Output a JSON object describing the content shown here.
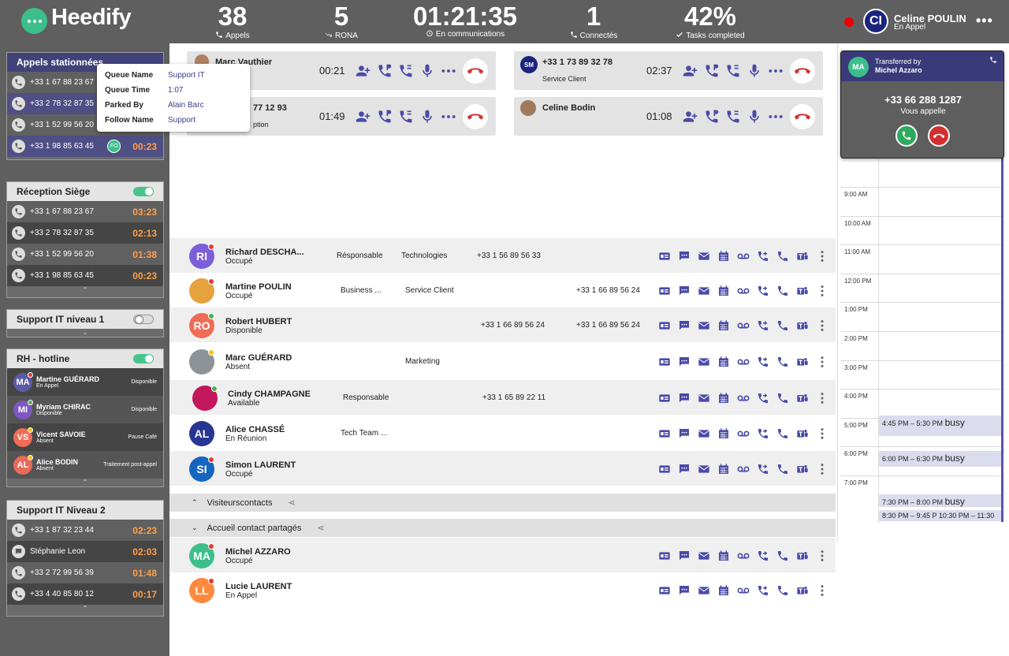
{
  "brand": {
    "name": "Heedify"
  },
  "stats": [
    {
      "value": "38",
      "label": "Appels"
    },
    {
      "value": "5",
      "label": "RONA"
    },
    {
      "value": "01:21:35",
      "label": "En communications"
    },
    {
      "value": "1",
      "label": "Connectés"
    },
    {
      "value": "42%",
      "label": "Tasks completed"
    }
  ],
  "user": {
    "initials": "CI",
    "name": "Celine POULIN",
    "status": "En Appel"
  },
  "parked": {
    "title": "Appels stationnées",
    "rows": [
      {
        "number": "+33 1 67 88 23 67"
      },
      {
        "number": "+33 2 78 32 87 35"
      },
      {
        "number": "+33 1 52 99 56 20"
      },
      {
        "number": "+33 1 98 85 63 45",
        "badge": "FO",
        "time": "00:23"
      }
    ]
  },
  "tooltip": {
    "rows": [
      {
        "key": "Queue Name",
        "value": "Support IT"
      },
      {
        "key": "Queue Time",
        "value": "1:07"
      },
      {
        "key": "Parked By",
        "value": "Alain Barc"
      },
      {
        "key": "Follow Name",
        "value": "Support"
      }
    ]
  },
  "reception": {
    "title": "Réception Siège",
    "rows": [
      {
        "number": "+33 1 67 88 23 67",
        "time": "03:23"
      },
      {
        "number": "+33 2 78 32 87 35",
        "time": "02:13"
      },
      {
        "number": "+33 1 52 99 56 20",
        "time": "01:38"
      },
      {
        "number": "+33 1 98 85 63 45",
        "time": "00:23"
      }
    ]
  },
  "support1": {
    "title": "Support IT niveau 1"
  },
  "rh": {
    "title": "RH - hotline",
    "rows": [
      {
        "initials": "MA",
        "name": "Martine GUÉRARD",
        "sub": "En Appel",
        "right": "Disponible",
        "color": "#5b5ba5",
        "dot": "#e53935"
      },
      {
        "initials": "MI",
        "name": "Myriam CHIRAC",
        "sub": "Disponible",
        "right": "Disponible",
        "color": "#7e57c2",
        "dot": "#4caf50"
      },
      {
        "initials": "VS",
        "name": "Vicent SAVOIE",
        "sub": "Absent",
        "right": "Pause Café",
        "color": "#ef6c57",
        "dot": "#ffc107"
      },
      {
        "initials": "AL",
        "name": "Alice BODIN",
        "sub": "Absent",
        "right": "Traitement post-appel",
        "color": "#e86a5a",
        "dot": "#ffc107"
      }
    ]
  },
  "support2": {
    "title": "Support IT Niveau 2",
    "rows": [
      {
        "number": "+33 1 87 32 23 44",
        "time": "02:23"
      },
      {
        "number": "Stéphanie Leon",
        "time": "02:03"
      },
      {
        "number": "+33 2 72 99 56 39",
        "time": "01:48"
      },
      {
        "number": "+33 4 40 85 80 12",
        "time": "00:17"
      }
    ]
  },
  "calls": [
    {
      "name": "Marc Vauthier",
      "sub": "",
      "time": "00:21"
    },
    {
      "name": "+33 1 73 89 32 78",
      "initials": "SM",
      "sub": "Service Client",
      "time": "02:37"
    },
    {
      "name": "77 12 93",
      "sub": "ption",
      "time": "01:49"
    },
    {
      "name": "Celine Bodin",
      "sub": "",
      "time": "01:08"
    }
  ],
  "contacts": [
    {
      "initials": "RI",
      "name": "Richard DESCHA...",
      "status": "Occupé",
      "color": "#7b5fd8",
      "dot": "#e53935",
      "f1": "Résponsable",
      "f2": "Technologies",
      "f3": "+33 1 56 89 56 33",
      "f4": ""
    },
    {
      "initials": "",
      "name": "Martine POULIN",
      "status": "Occupé",
      "color": "#e6a23c",
      "dot": "#e53935",
      "f1": "Business ...",
      "f2": "Service Client",
      "f3": "",
      "f4": "+33 1 66 89 56 24"
    },
    {
      "initials": "RO",
      "name": "Robert HUBERT",
      "status": "Disponible",
      "color": "#ef6c57",
      "dot": "#4caf50",
      "f1": "",
      "f2": "",
      "f3": "+33 1 66 89 56 24",
      "f4": "+33 1 66 89 56 24"
    },
    {
      "initials": "",
      "name": "Marc GUÉRARD",
      "status": "Absent",
      "color": "#8d9499",
      "dot": "#ffc107",
      "f1": "",
      "f2": "Marketing",
      "f3": "",
      "f4": ""
    },
    {
      "initials": "",
      "name": "Cindy CHAMPAGNE",
      "status": "Available",
      "color": "#c2185b",
      "dot": "#4caf50",
      "f1": "Responsable",
      "f2": "",
      "f3": "+33 1 65 89 22 11",
      "f4": ""
    },
    {
      "initials": "AL",
      "name": "Alice CHASSÉ",
      "status": "En Réunion",
      "color": "#283593",
      "dot": "",
      "f1": "Tech Team ...",
      "f2": "",
      "f3": "",
      "f4": ""
    },
    {
      "initials": "SI",
      "name": "Simon LAURENT",
      "status": "Occupé",
      "color": "#1565c0",
      "dot": "#e53935",
      "f1": "",
      "f2": "",
      "f3": "",
      "f4": ""
    }
  ],
  "groups": [
    {
      "label": "Visiteurscontacts"
    },
    {
      "label": "Accueil  contact partagés"
    }
  ],
  "shared": [
    {
      "initials": "MA",
      "name": "Michel AZZARO",
      "status": "Occupé",
      "color": "#3dbf8c",
      "dot": "#e53935"
    },
    {
      "initials": "LL",
      "name": "Lucie LAURENT",
      "status": "En Appel",
      "color": "#ff8a3d",
      "dot": "#e53935"
    }
  ],
  "incoming": {
    "initials": "MA",
    "transferred_label": "Transferred by",
    "transferred_name": "Michel Azzaro",
    "number": "+33 66 288 1287",
    "caption": "Vous appelle"
  },
  "calendar": {
    "hours": [
      "9:00 AM",
      "10:00 AM",
      "11:00 AM",
      "12:00 PM",
      "1:00 PM",
      "2:00 PM",
      "3:00 PM",
      "4:00 PM",
      "5:00 PM",
      "6:00 PM",
      "7:00 PM"
    ],
    "events": [
      {
        "time": "4:45 PM – 5:30 PM",
        "label": "busy"
      },
      {
        "time": "6:00 PM – 6:30 PM",
        "label": "busy"
      },
      {
        "time": "7:30 PM – 8:00 PM",
        "label": "busy"
      },
      {
        "time": "8:30 PM – 9:45 P",
        "label": "10:30 PM – 11:30"
      }
    ]
  },
  "colors": {
    "accent": "#4a4aa8",
    "header": "#5f5f5f",
    "timer": "#ff9f4a",
    "hangup": "#d32f2f",
    "answer": "#2eaa5e"
  }
}
